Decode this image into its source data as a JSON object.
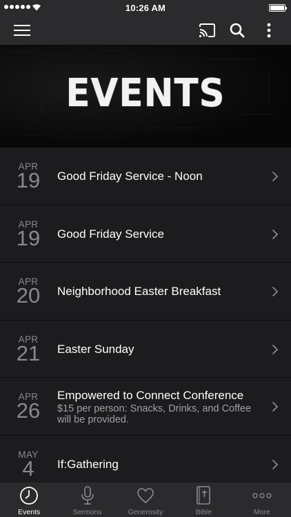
{
  "status_bar": {
    "time": "10:26 AM"
  },
  "header": {
    "menu_icon": "hamburger-menu-icon",
    "cast_icon": "cast-icon",
    "search_icon": "search-icon",
    "more_icon": "vertical-dots-icon"
  },
  "hero": {
    "title": "EVENTS"
  },
  "events": [
    {
      "month": "APR",
      "day": "19",
      "title": "Good Friday Service - Noon",
      "subtitle": ""
    },
    {
      "month": "APR",
      "day": "19",
      "title": "Good Friday Service",
      "subtitle": ""
    },
    {
      "month": "APR",
      "day": "20",
      "title": "Neighborhood Easter Breakfast",
      "subtitle": ""
    },
    {
      "month": "APR",
      "day": "21",
      "title": "Easter Sunday",
      "subtitle": ""
    },
    {
      "month": "APR",
      "day": "26",
      "title": "Empowered to Connect Conference",
      "subtitle": "$15 per person: Snacks, Drinks, and Coffee will be provided."
    },
    {
      "month": "MAY",
      "day": "4",
      "title": "If:Gathering",
      "subtitle": ""
    }
  ],
  "tabs": [
    {
      "label": "Events",
      "icon": "clock-icon",
      "active": true
    },
    {
      "label": "Sermons",
      "icon": "microphone-icon",
      "active": false
    },
    {
      "label": "Generosity",
      "icon": "heart-icon",
      "active": false
    },
    {
      "label": "Bible",
      "icon": "bible-icon",
      "active": false
    },
    {
      "label": "More",
      "icon": "more-dots-icon",
      "active": false
    }
  ],
  "colors": {
    "bar": "#2b2b2d",
    "list_bg": "#1c1c1e",
    "date_text": "#8a8a8e",
    "inactive_tab": "#8c8c90"
  }
}
